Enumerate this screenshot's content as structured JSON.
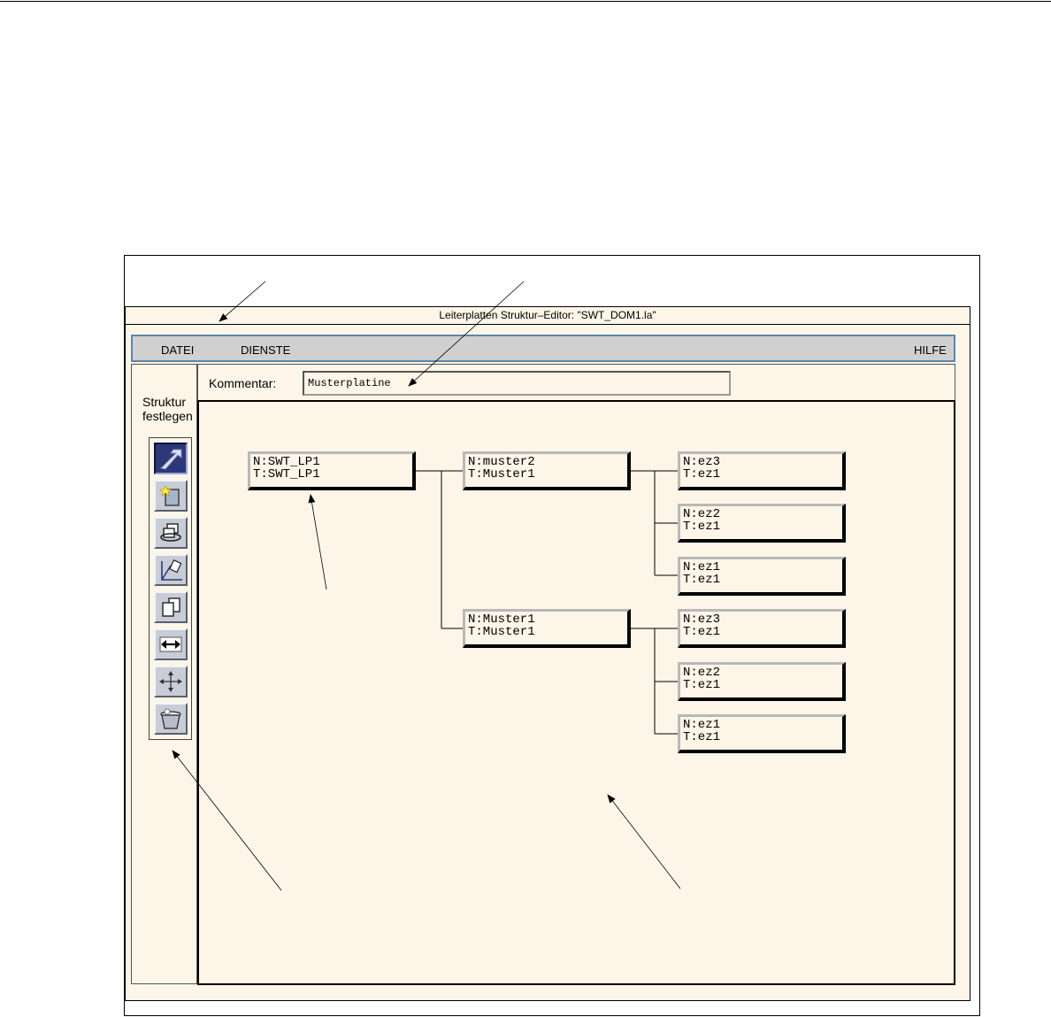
{
  "window": {
    "title": "Leiterplatten Struktur–Editor: \"SWT_DOM1.la\""
  },
  "menu": {
    "datei": "DATEI",
    "dienste": "DIENSTE",
    "hilfe": "HILFE"
  },
  "left_panel": {
    "label_line1": "Struktur",
    "label_line2": "festlegen"
  },
  "toolbar": {
    "tools": [
      {
        "icon": "select-arrow-icon",
        "active": true
      },
      {
        "icon": "new-node-icon",
        "active": false
      },
      {
        "icon": "rotate-copy-icon",
        "active": false
      },
      {
        "icon": "edit-link-icon",
        "active": false
      },
      {
        "icon": "copy-icon",
        "active": false
      },
      {
        "icon": "swap-icon",
        "active": false
      },
      {
        "icon": "move-icon",
        "active": false
      },
      {
        "icon": "trash-icon",
        "active": false
      }
    ]
  },
  "comment": {
    "label": "Kommentar:",
    "value": "Musterplatine"
  },
  "tree": {
    "root": {
      "n": "N:SWT_LP1",
      "t": "T:SWT_LP1"
    },
    "level1": [
      {
        "n": "N:muster2",
        "t": "T:Muster1"
      },
      {
        "n": "N:Muster1",
        "t": "T:Muster1"
      }
    ],
    "level2": [
      {
        "n": "N:ez3",
        "t": "T:ez1"
      },
      {
        "n": "N:ez2",
        "t": "T:ez1"
      },
      {
        "n": "N:ez1",
        "t": "T:ez1"
      },
      {
        "n": "N:ez3",
        "t": "T:ez1"
      },
      {
        "n": "N:ez2",
        "t": "T:ez1"
      },
      {
        "n": "N:ez1",
        "t": "T:ez1"
      }
    ]
  }
}
